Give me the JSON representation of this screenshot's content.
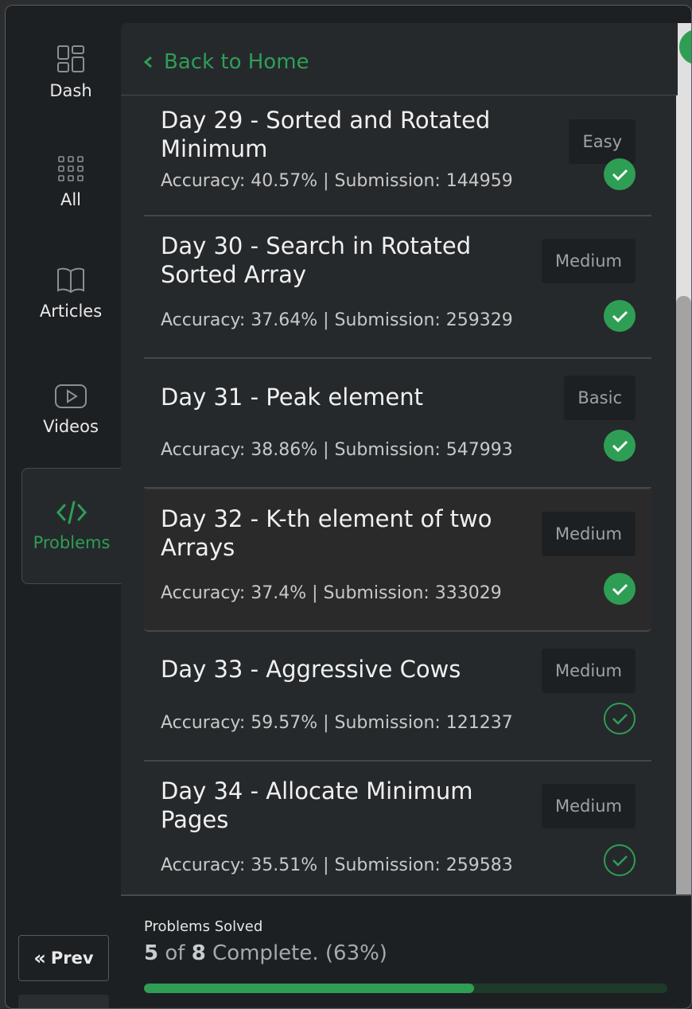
{
  "sidebar": {
    "items": [
      {
        "label": "Dash",
        "icon": "dashboard-icon"
      },
      {
        "label": "All",
        "icon": "grid-icon"
      },
      {
        "label": "Articles",
        "icon": "book-icon"
      },
      {
        "label": "Videos",
        "icon": "video-icon"
      },
      {
        "label": "Problems",
        "icon": "code-icon",
        "active": true
      }
    ],
    "prev_label": "Prev"
  },
  "header": {
    "back_label": "Back to Home"
  },
  "problems": [
    {
      "title": "Day 29 - Sorted and Rotated Minimum",
      "difficulty": "Easy",
      "accuracy": "Accuracy: 40.57% | Submission: 144959",
      "solved": true
    },
    {
      "title": "Day 30 - Search in Rotated Sorted Array",
      "difficulty": "Medium",
      "accuracy": "Accuracy: 37.64% | Submission: 259329",
      "solved": true
    },
    {
      "title": "Day 31 - Peak element",
      "difficulty": "Basic",
      "accuracy": "Accuracy: 38.86% | Submission: 547993",
      "solved": true
    },
    {
      "title": "Day 32 - K-th element of two Arrays",
      "difficulty": "Medium",
      "accuracy": "Accuracy: 37.4% | Submission: 333029",
      "solved": true
    },
    {
      "title": "Day 33 - Aggressive Cows",
      "difficulty": "Medium",
      "accuracy": "Accuracy: 59.57% | Submission: 121237",
      "solved": false
    },
    {
      "title": "Day 34 - Allocate Minimum Pages",
      "difficulty": "Medium",
      "accuracy": "Accuracy: 35.51% | Submission: 259583",
      "solved": false
    }
  ],
  "progress": {
    "label": "Problems Solved",
    "solved": "5",
    "of_text": " of ",
    "total": "8",
    "suffix": " Complete. (63%)",
    "fraction": 0.63
  },
  "colors": {
    "accent": "#2f9e55",
    "panel": "#25292c",
    "sidebar": "#1d2023"
  }
}
